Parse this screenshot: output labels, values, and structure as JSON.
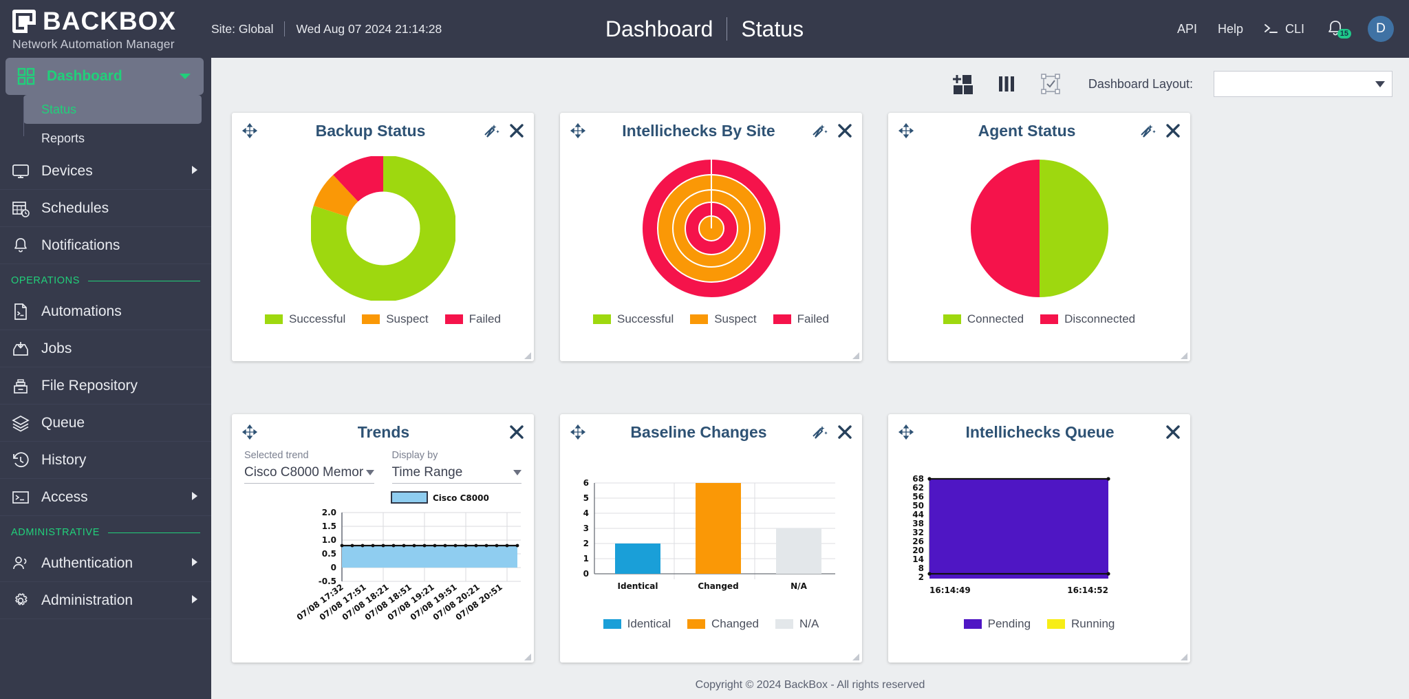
{
  "header": {
    "brand_name": "BACKBOX",
    "brand_sub": "Network Automation Manager",
    "site": "Site: Global",
    "datetime": "Wed Aug 07 2024 21:14:28",
    "title_main": "Dashboard",
    "title_sub": "Status",
    "api_label": "API",
    "help_label": "Help",
    "cli_label": "CLI",
    "notification_count": "15",
    "avatar_initial": "D"
  },
  "sidebar": {
    "dashboard": {
      "label": "Dashboard",
      "sub": [
        {
          "label": "Status"
        },
        {
          "label": "Reports"
        }
      ]
    },
    "items": [
      {
        "label": "Devices",
        "icon": "monitor-icon",
        "has_caret": true
      },
      {
        "label": "Schedules",
        "icon": "calendar-clock-icon",
        "has_caret": false
      },
      {
        "label": "Notifications",
        "icon": "bell-icon",
        "has_caret": false
      }
    ],
    "operations_label": "OPERATIONS",
    "operations": [
      {
        "label": "Automations",
        "icon": "script-icon",
        "has_caret": false
      },
      {
        "label": "Jobs",
        "icon": "inbox-down-icon",
        "has_caret": false
      },
      {
        "label": "File Repository",
        "icon": "file-drawer-icon",
        "has_caret": false
      },
      {
        "label": "Queue",
        "icon": "layers-icon",
        "has_caret": false
      },
      {
        "label": "History",
        "icon": "clock-back-icon",
        "has_caret": false
      },
      {
        "label": "Access",
        "icon": "terminal-icon",
        "has_caret": true
      }
    ],
    "administrative_label": "ADMINISTRATIVE",
    "administrative": [
      {
        "label": "Authentication",
        "icon": "users-icon",
        "has_caret": true
      },
      {
        "label": "Administration",
        "icon": "gear-icon",
        "has_caret": true
      }
    ]
  },
  "toolbar": {
    "add_widget_icon": "add-widget-icon",
    "columns_icon": "columns-icon",
    "select_layout_icon": "select-frame-icon",
    "layout_label": "Dashboard Layout:",
    "layout_value": ""
  },
  "widgets": [
    {
      "title": "Backup Status"
    },
    {
      "title": "Intellichecks By Site"
    },
    {
      "title": "Agent Status"
    },
    {
      "title": "Trends"
    },
    {
      "title": "Baseline Changes"
    },
    {
      "title": "Intellichecks Queue"
    }
  ],
  "trends": {
    "selected_trend_label": "Selected trend",
    "selected_trend_value": "Cisco C8000 Memor",
    "display_by_label": "Display by",
    "display_by_value": "Time Range"
  },
  "footer": {
    "text": "Copyright © 2024 BackBox - All rights reserved"
  },
  "colors": {
    "green": "#9ed80f",
    "orange": "#fa9806",
    "red": "#f5134b",
    "blue": "#1a9fd8",
    "gray": "#e3e7ea",
    "purple": "#4f16c4",
    "yellow": "#f7ed16",
    "lightblue": "#8fcdf0",
    "accent": "#21d07a",
    "navy": "#2e5274",
    "sidebar": "#363a4b"
  },
  "chart_data": [
    {
      "type": "pie",
      "title": "Backup Status",
      "donut": true,
      "labels": [
        "Successful",
        "Suspect",
        "Failed"
      ],
      "values": [
        80,
        8,
        12
      ],
      "colors": [
        "#9ed80f",
        "#fa9806",
        "#f5134b"
      ],
      "legend": "bottom"
    },
    {
      "type": "pie",
      "title": "Intellichecks By Site",
      "sunburst": true,
      "labels": [
        "Successful",
        "Suspect",
        "Failed"
      ],
      "colors": [
        "#9ed80f",
        "#fa9806",
        "#f5134b"
      ],
      "rings": [
        {
          "radius": 100,
          "color": "#f5134b"
        },
        {
          "radius": 78,
          "color": "#fa9806"
        },
        {
          "radius": 56,
          "color": "#fa9806"
        },
        {
          "radius": 38,
          "color": "#f5134b"
        },
        {
          "radius": 18,
          "color": "#fa9806"
        }
      ],
      "values": [
        0,
        60,
        40
      ],
      "legend": "bottom"
    },
    {
      "type": "pie",
      "title": "Agent Status",
      "donut": false,
      "labels": [
        "Connected",
        "Disconnected"
      ],
      "values": [
        50,
        50
      ],
      "colors": [
        "#9ed80f",
        "#f5134b"
      ],
      "legend": "bottom"
    },
    {
      "type": "area",
      "title": "Trends",
      "series": [
        {
          "name": "Cisco C8000",
          "values": [
            0.9,
            0.9,
            0.9,
            0.9,
            0.9,
            0.9,
            0.9,
            0.9,
            0.9,
            0.9,
            0.9,
            0.9,
            0.9,
            0.9,
            0.9,
            0.9,
            0.9,
            0.9,
            0.9,
            0.9
          ]
        }
      ],
      "x": [
        "07/08 17:32",
        "07/08 17:51",
        "07/08 18:21",
        "07/08 18:51",
        "07/08 19:21",
        "07/08 19:51",
        "07/08 20:21",
        "07/08 20:51"
      ],
      "yticks": [
        "2.0",
        "1.5",
        "1.0",
        "0.5",
        "0",
        "-0.5"
      ],
      "ylim": [
        -0.5,
        2.0
      ],
      "grid": true,
      "legend": "top",
      "colors": [
        "#8fcdf0"
      ]
    },
    {
      "type": "bar",
      "title": "Baseline Changes",
      "categories": [
        "Identical",
        "Changed",
        "N/A"
      ],
      "values": [
        2,
        6,
        3
      ],
      "colors": [
        "#1a9fd8",
        "#fa9806",
        "#e3e7ea"
      ],
      "yticks": [
        "0",
        "1",
        "2",
        "3",
        "4",
        "5",
        "6"
      ],
      "ylim": [
        0,
        6
      ],
      "grid": true,
      "legend": "bottom",
      "legend_labels": [
        "Identical",
        "Changed",
        "N/A"
      ]
    },
    {
      "type": "area",
      "title": "Intellichecks Queue",
      "series": [
        {
          "name": "Pending",
          "values": [
            68,
            68
          ]
        },
        {
          "name": "Running",
          "values": [
            3,
            3
          ]
        }
      ],
      "x": [
        "16:14:49",
        "16:14:52"
      ],
      "yticks": [
        "68",
        "62",
        "56",
        "50",
        "44",
        "38",
        "32",
        "26",
        "20",
        "14",
        "8",
        "2"
      ],
      "ylim": [
        2,
        68
      ],
      "grid": false,
      "legend": "bottom",
      "colors": [
        "#4f16c4",
        "#f7ed16"
      ]
    }
  ]
}
